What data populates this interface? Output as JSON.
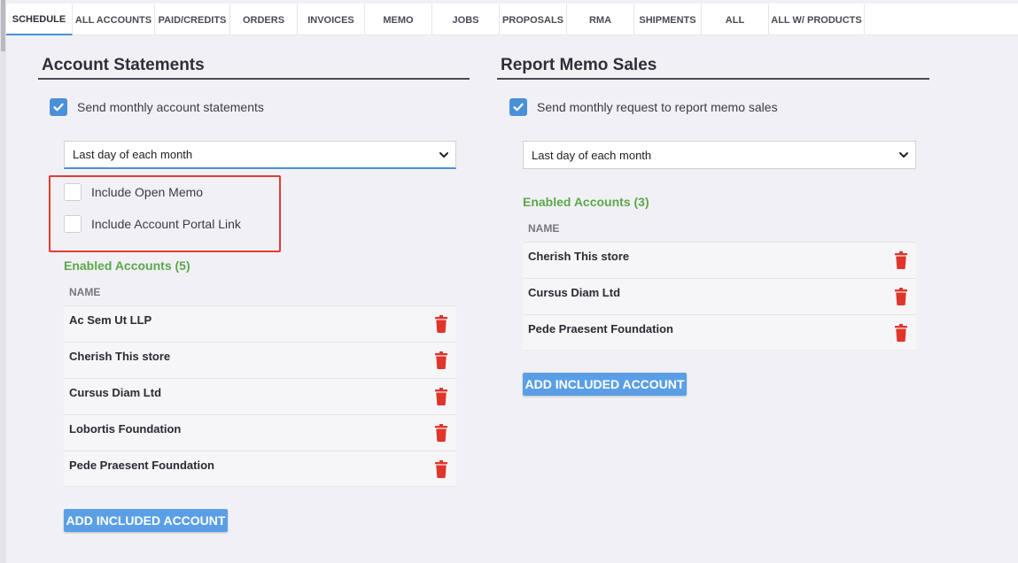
{
  "tabs": [
    {
      "label": "SCHEDULE",
      "active": true
    },
    {
      "label": "ALL ACCOUNTS"
    },
    {
      "label": "PAID/CREDITS"
    },
    {
      "label": "ORDERS"
    },
    {
      "label": "INVOICES"
    },
    {
      "label": "MEMO"
    },
    {
      "label": "JOBS"
    },
    {
      "label": "PROPOSALS"
    },
    {
      "label": "RMA"
    },
    {
      "label": "SHIPMENTS"
    },
    {
      "label": "ALL"
    },
    {
      "label": "ALL W/ PRODUCTS"
    }
  ],
  "left": {
    "title": "Account Statements",
    "send_label": "Send monthly account statements",
    "send_checked": true,
    "schedule_value": "Last day of each month",
    "include_open_memo_label": "Include Open Memo",
    "include_portal_link_label": "Include Account Portal Link",
    "enabled_title": "Enabled Accounts (5)",
    "name_header": "NAME",
    "accounts": [
      "Ac Sem Ut LLP",
      "Cherish This store",
      "Cursus Diam Ltd",
      "Lobortis Foundation",
      "Pede Praesent Foundation"
    ],
    "add_button": "ADD INCLUDED ACCOUNT"
  },
  "right": {
    "title": "Report Memo Sales",
    "send_label": "Send monthly request to report memo sales",
    "send_checked": true,
    "schedule_value": "Last day of each month",
    "enabled_title": "Enabled Accounts (3)",
    "name_header": "NAME",
    "accounts": [
      "Cherish This store",
      "Cursus Diam Ltd",
      "Pede Praesent Foundation"
    ],
    "add_button": "ADD INCLUDED ACCOUNT"
  },
  "colors": {
    "accent": "#4a90d9",
    "enabled_green": "#5aa84a",
    "delete_red": "#e0352b",
    "highlight_red": "#e53935"
  }
}
